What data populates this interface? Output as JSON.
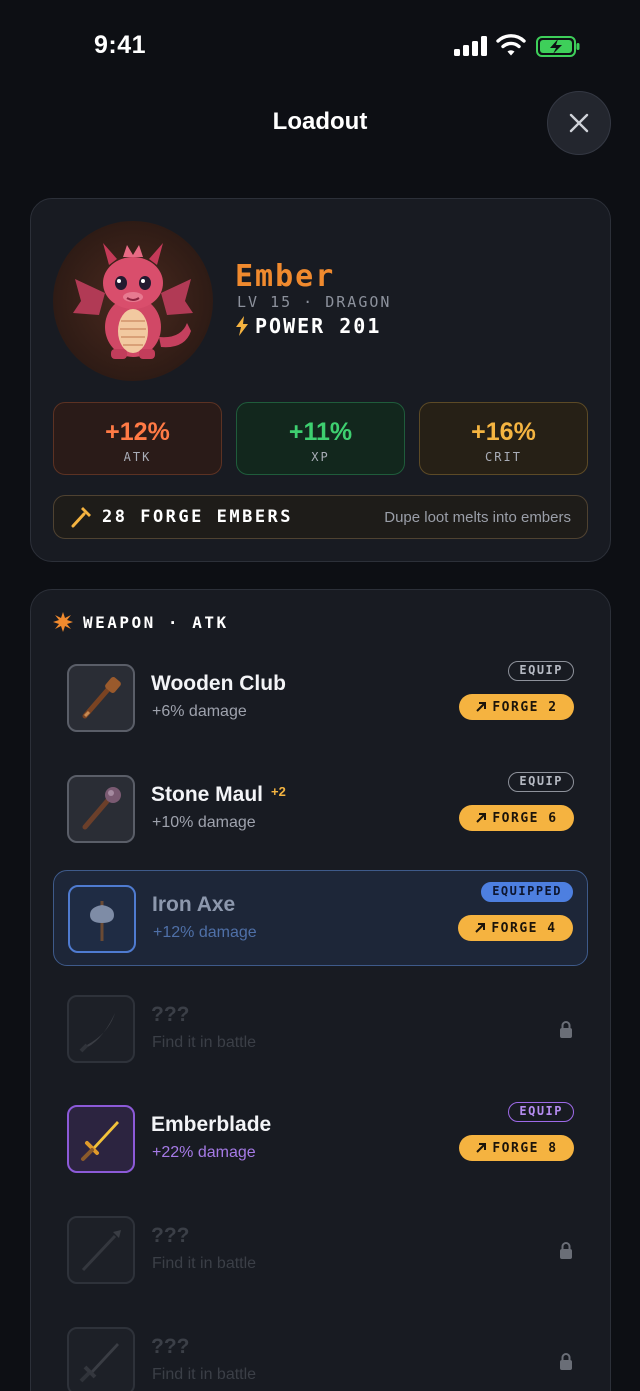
{
  "status": {
    "time": "9:41"
  },
  "header": {
    "title": "Loadout"
  },
  "hero": {
    "name": "Ember",
    "subtitle": "LV 15 · DRAGON",
    "power": "POWER 201",
    "stats": [
      {
        "value": "+12%",
        "label": "ATK"
      },
      {
        "value": "+11%",
        "label": "XP"
      },
      {
        "value": "+16%",
        "label": "CRIT"
      }
    ],
    "embers": {
      "count": "28 FORGE EMBERS",
      "hint": "Dupe loot melts into embers"
    }
  },
  "panel": {
    "heading": "WEAPON · ATK",
    "items": [
      {
        "name": "Wooden Club",
        "plus": "",
        "desc": "+6% damage",
        "equip": "EQUIP",
        "forge": "FORGE 2"
      },
      {
        "name": "Stone Maul",
        "plus": "+2",
        "desc": "+10% damage",
        "equip": "EQUIP",
        "forge": "FORGE 6"
      },
      {
        "name": "Iron Axe",
        "plus": "",
        "desc": "+12% damage",
        "equip": "EQUIPPED",
        "forge": "FORGE 4"
      },
      {
        "name": "???",
        "desc": "Find it in battle"
      },
      {
        "name": "Emberblade",
        "plus": "",
        "desc": "+22% damage",
        "equip": "EQUIP",
        "forge": "FORGE 8"
      },
      {
        "name": "???",
        "desc": "Find it in battle"
      },
      {
        "name": "???",
        "desc": "Find it in battle"
      }
    ]
  },
  "colors": {
    "accent": "#f5b340",
    "equipped": "#4d7fe0",
    "epic": "#8c5ad8",
    "ember": "#f08a2e"
  }
}
